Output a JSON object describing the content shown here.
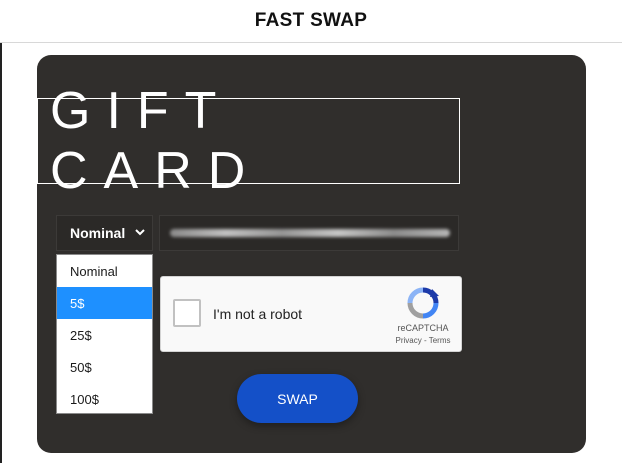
{
  "header": {
    "title": "FAST SWAP"
  },
  "card": {
    "title": "GIFT CARD"
  },
  "nominal_select": {
    "selected": "Nominal",
    "options": [
      "Nominal",
      "5$",
      "25$",
      "50$",
      "100$"
    ],
    "highlighted_index": 1
  },
  "recaptcha": {
    "label": "I'm not a robot",
    "brand": "reCAPTCHA",
    "privacy": "Privacy",
    "separator": " - ",
    "terms": "Terms"
  },
  "swap_button": {
    "label": "SWAP"
  },
  "colors": {
    "card_bg": "#302e2c",
    "button_bg": "#1450c8",
    "option_highlight": "#1e90ff"
  }
}
